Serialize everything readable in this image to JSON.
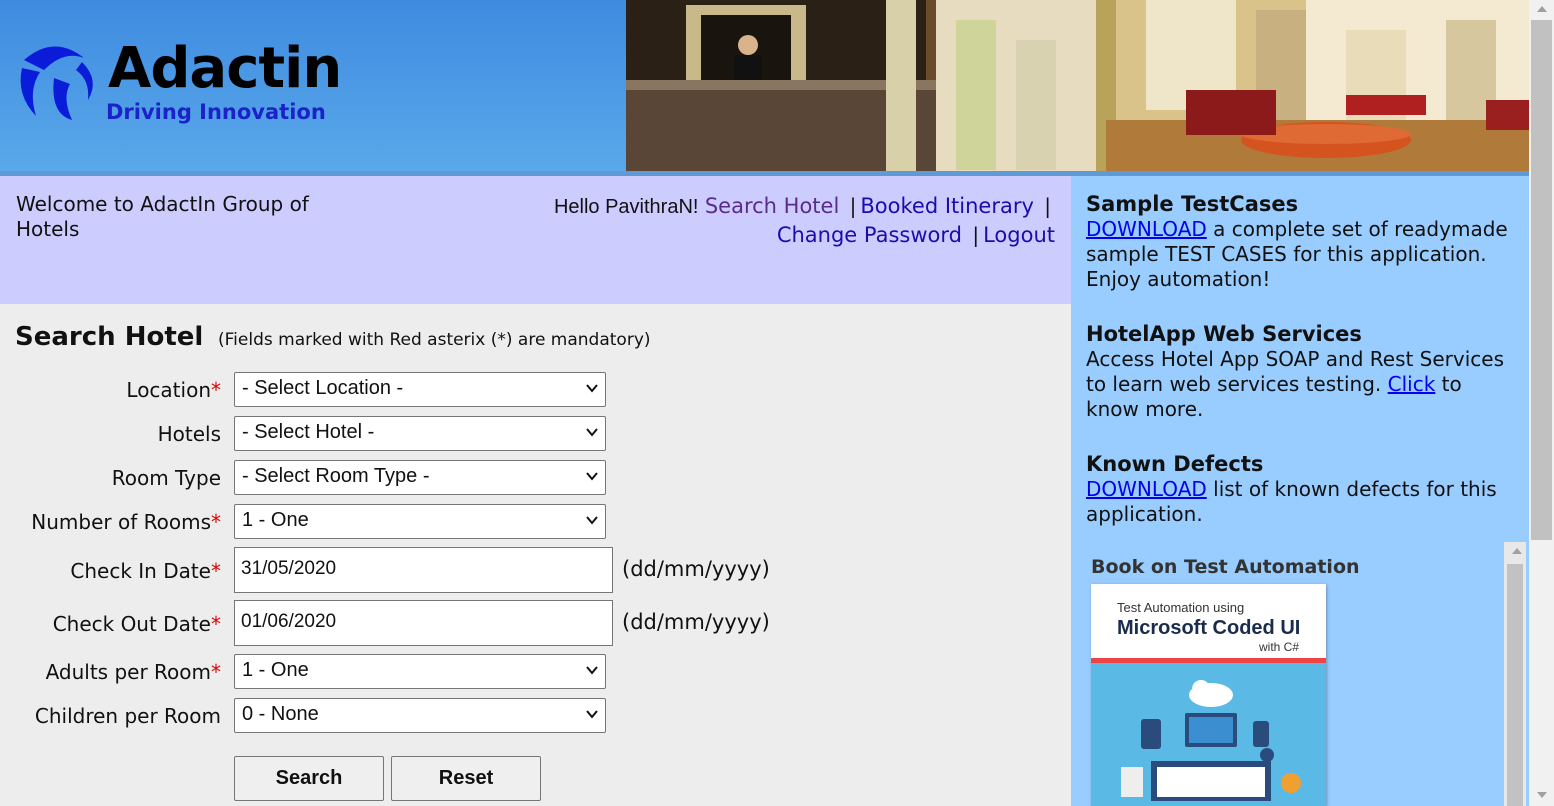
{
  "brand": {
    "name": "Adactin",
    "tagline": "Driving Innovation"
  },
  "welcome": {
    "text": "Welcome to AdactIn Group of Hotels"
  },
  "nav": {
    "greeting": "Hello PavithraN!",
    "search_hotel": "Search Hotel",
    "booked_itinerary": "Booked Itinerary",
    "change_password": "Change Password",
    "logout": "Logout",
    "separator": "|"
  },
  "form": {
    "title": "Search Hotel",
    "note": "(Fields marked with Red asterix (*) are mandatory)",
    "required_mark": "*",
    "location": {
      "label": "Location",
      "value": "- Select Location -"
    },
    "hotels": {
      "label": "Hotels",
      "value": "- Select Hotel -"
    },
    "room_type": {
      "label": "Room Type",
      "value": "- Select Room Type -"
    },
    "rooms": {
      "label": "Number of Rooms",
      "value": "1 - One"
    },
    "check_in": {
      "label": "Check In Date",
      "value": "31/05/2020",
      "hint": "(dd/mm/yyyy)"
    },
    "check_out": {
      "label": "Check Out Date",
      "value": "01/06/2020",
      "hint": "(dd/mm/yyyy)"
    },
    "adults": {
      "label": "Adults per Room",
      "value": "1 - One"
    },
    "children": {
      "label": "Children per Room",
      "value": "0 - None"
    },
    "search_button": "Search",
    "reset_button": "Reset"
  },
  "sidebar": {
    "testcases": {
      "title": "Sample TestCases",
      "link": "DOWNLOAD",
      "text": " a complete set of readymade sample TEST CASES for this application. Enjoy automation!"
    },
    "webservices": {
      "title": "HotelApp Web Services",
      "text1": "Access Hotel App SOAP and Rest Services to learn web services testing. ",
      "link": "Click",
      "text2": " to know more."
    },
    "defects": {
      "title": "Known Defects",
      "link": "DOWNLOAD",
      "text": " list of known defects for this application."
    },
    "book": {
      "heading": "Book on Test Automation",
      "cover_line1": "Test Automation using",
      "cover_line2": "Microsoft Coded UI",
      "cover_line3": "with C#"
    }
  },
  "colors": {
    "header_blue": "#4a97e5",
    "welcome_bg": "#ccccff",
    "sidebar_bg": "#99ccff",
    "required_red": "#e00000",
    "tagline_blue": "#1b22c9"
  }
}
